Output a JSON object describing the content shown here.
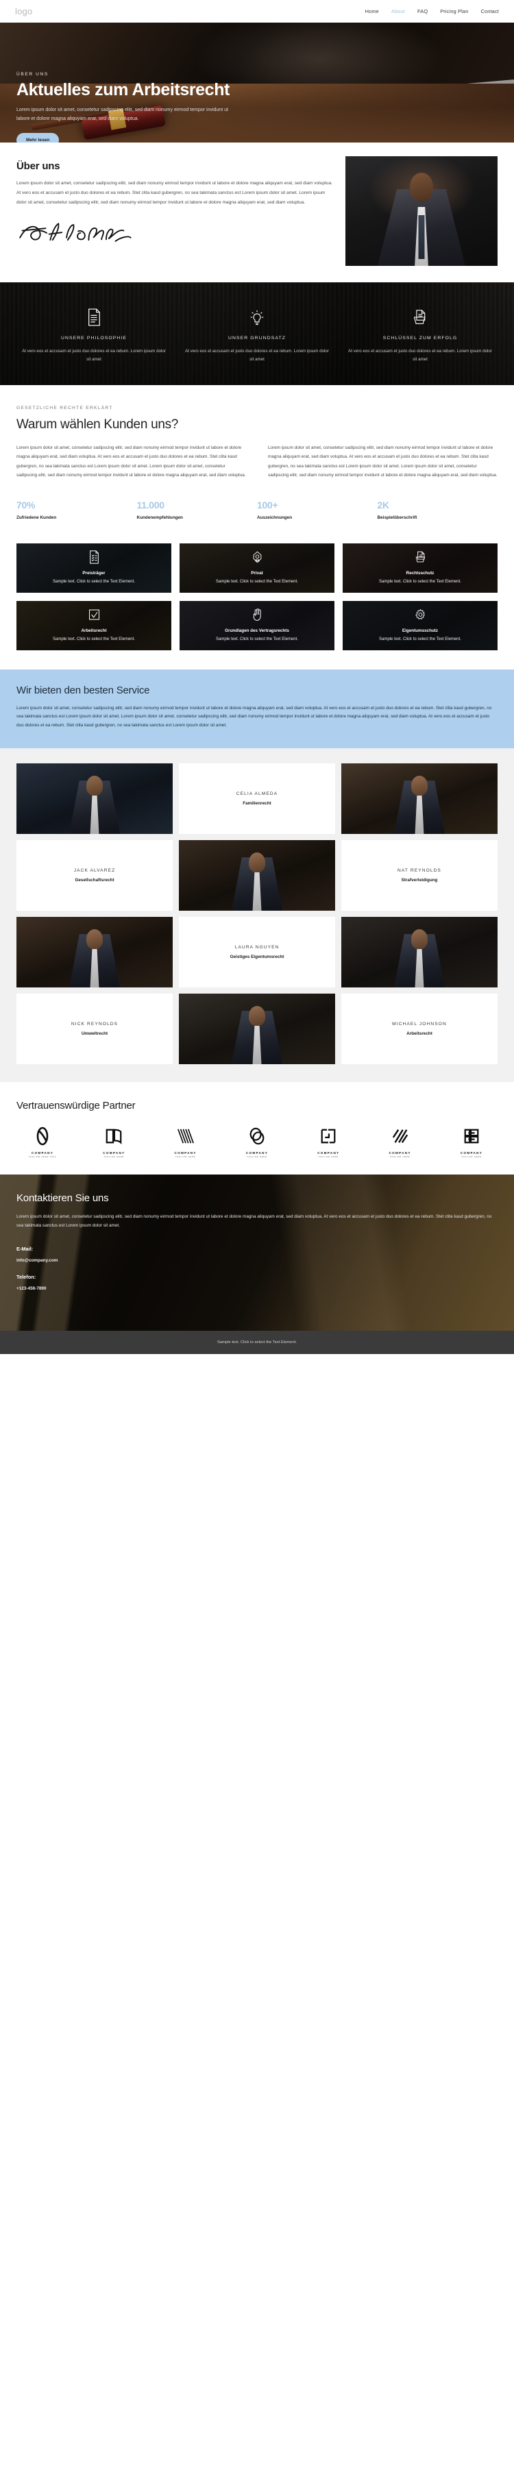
{
  "header": {
    "logo": "logo",
    "nav": [
      {
        "label": "Home",
        "active": false
      },
      {
        "label": "About",
        "active": true
      },
      {
        "label": "FAQ",
        "active": false
      },
      {
        "label": "Pricing Plan",
        "active": false
      },
      {
        "label": "Contact",
        "active": false
      }
    ]
  },
  "hero": {
    "eyebrow": "ÜBER UNS",
    "title": "Aktuelles zum Arbeitsrecht",
    "paragraph": "Lorem ipsum dolor sit amet, consetetur sadipscing elitr, sed diam nonumy eirmod tempor invidunt ut labore et dolore magna aliquyam erat, sed diam voluptua.",
    "button": "Mehr lesen",
    "accent_color": "#aed0ee"
  },
  "about": {
    "title": "Über uns",
    "paragraph": "Lorem ipsum dolor sit amet, consetetur sadipscing elitr, sed diam nonumy eirmod tempor invidunt ut labore et dolore magna aliquyam erat, sed diam voluptua. At vero eos et accusam et justo duo dolores et ea rebum. Stet clita kasd gubergren, no sea takimata sanctus est Lorem ipsum dolor sit amet. Lorem ipsum dolor sit amet, consetetur sadipscing elitr, sed diam nonumy eirmod tempor invidunt ut labore et dolore magna aliquyam erat, sed diam voluptua."
  },
  "features": [
    {
      "icon": "document-lines-icon",
      "title": "UNSERE PHILOSOPHIE",
      "text": "At vero eos et accusam et justo duo dolores et ea rebum. Lorem ipsum dolor sit amet"
    },
    {
      "icon": "lightbulb-icon",
      "title": "UNSER GRUNDSATZ",
      "text": "At vero eos et accusam et justo duo dolores et ea rebum. Lorem ipsum dolor sit amet"
    },
    {
      "icon": "folder-document-icon",
      "title": "SCHLÜSSEL ZUM ERFOLG",
      "text": "At vero eos et accusam et justo duo dolores et ea rebum. Lorem ipsum dolor sit amet"
    }
  ],
  "why": {
    "kicker": "GESETZLICHE RECHTE ERKLÄRT",
    "title": "Warum wählen Kunden uns?",
    "col1": "Lorem ipsum dolor sit amet, consetetur sadipscing elitr, sed diam nonumy eirmod tempor invidunt ut labore et dolore magna aliquyam erat, sed diam voluptua. At vero eos et accusam et justo duo dolores et ea rebum. Stet clita kasd gubergren, no sea takimata sanctus est Lorem ipsum dolor sit amet. Lorem ipsum dolor sit amet, consetetur sadipscing elitr, sed diam nonumy eirmod tempor invidunt ut labore et dolore magna aliquyam erat, sed diam voluptua.",
    "col2": "Lorem ipsum dolor sit amet, consetetur sadipscing elitr, sed diam nonumy eirmod tempor invidunt ut labore et dolore magna aliquyam erat, sed diam voluptua. At vero eos et accusam et justo duo dolores et ea rebum. Stet clita kasd gubergren, no sea takimata sanctus est Lorem ipsum dolor sit amet. Lorem ipsum dolor sit amet, consetetur sadipscing elitr, sed diam nonumy eirmod tempor invidunt ut labore et dolore magna aliquyam erat, sed diam voluptua."
  },
  "stats": [
    {
      "value": "70%",
      "label": "Zufriedene Kunden"
    },
    {
      "value": "11.000",
      "label": "Kundenempfehlungen"
    },
    {
      "value": "100+",
      "label": "Auszeichnungen"
    },
    {
      "value": "2K",
      "label": "Beispielüberschrift"
    }
  ],
  "gallery": [
    {
      "icon": "checklist-document-icon",
      "title": "Preisträger",
      "text": "Sample text. Click to select the Text Element."
    },
    {
      "icon": "handshake-icon",
      "title": "Privat",
      "text": "Sample text. Click to select the Text Element."
    },
    {
      "icon": "document-stack-icon",
      "title": "Rechtsschutz",
      "text": "Sample text. Click to select the Text Element."
    },
    {
      "icon": "checkbox-check-icon",
      "title": "Arbeitsrecht",
      "text": "Sample text. Click to select the Text Element."
    },
    {
      "icon": "raised-hand-icon",
      "title": "Grundlagen des Vertragsrechts",
      "text": "Sample text. Click to select the Text Element."
    },
    {
      "icon": "gear-icon",
      "title": "Eigentumsschutz",
      "text": "Sample text. Click to select the Text Element."
    }
  ],
  "service": {
    "title": "Wir bieten den besten Service",
    "text": "Lorem ipsum dolor sit amet, consetetur sadipscing elitr, sed diam nonumy eirmod tempor invidunt ut labore et dolore magna aliquyam erat, sed diam voluptua. At vero eos et accusam et justo duo dolores et ea rebum. Stet clita kasd gubergren, no sea takimata sanctus est Lorem ipsum dolor sit amet. Lorem ipsum dolor sit amet, consetetur sadipscing elitr, sed diam nonumy eirmod tempor invidunt ut labore et dolore magna aliquyam erat, sed diam voluptua. At vero eos et accusam et justo duo dolores et ea rebum. Stet clita kasd gubergren, no sea takimata sanctus est Lorem ipsum dolor sit amet.",
    "background_color": "#aed0ee"
  },
  "team": [
    {
      "name": "CELIA ALMEDA",
      "role": "Familienrecht"
    },
    {
      "name": "JACK ALVAREZ",
      "role": "Gesellschaftsrecht"
    },
    {
      "name": "NAT REYNOLDS",
      "role": "Strafverteidigung"
    },
    {
      "name": "LAURA NGUYEN",
      "role": "Geistiges Eigentumsrecht"
    },
    {
      "name": "NICK REYNOLDS",
      "role": "Umweltrecht"
    },
    {
      "name": "MICHAEL JOHNSON",
      "role": "Arbeitsrecht"
    }
  ],
  "partners": {
    "title": "Vertrauenswürdige Partner",
    "logos": [
      {
        "mark": "oval-loop-logo",
        "name": "COMPANY",
        "tagline": "TAGLINE HERE 2022"
      },
      {
        "mark": "open-book-logo",
        "name": "COMPANY",
        "tagline": "TAGLINE HERE"
      },
      {
        "mark": "striped-v-logo",
        "name": "COMPANY",
        "tagline": "TAGLINE HERE"
      },
      {
        "mark": "double-circle-logo",
        "name": "COMPANY",
        "tagline": "TAGLINE HERE"
      },
      {
        "mark": "bracket-square-logo",
        "name": "COMPANY",
        "tagline": "TAGLINE HERE"
      },
      {
        "mark": "slash-lines-logo",
        "name": "COMPANY",
        "tagline": "TAGLINE HERE"
      },
      {
        "mark": "blocks-b-logo",
        "name": "COMPANY",
        "tagline": "TAGLINE HERE"
      }
    ]
  },
  "contact": {
    "title": "Kontaktieren Sie uns",
    "lead": "Lorem ipsum dolor sit amet, consetetur sadipscing elitr, sed diam nonumy eirmod tempor invidunt ut labore et dolore magna aliquyam erat, sed diam voluptua. At vero eos et accusam et justo duo dolores et ea rebum. Stet clita kasd gubergren, no sea takimata sanctus est Lorem ipsum dolor sit amet.",
    "email_label": "E-Mail:",
    "email_value": "info@company.com",
    "phone_label": "Telefon:",
    "phone_value": "+123-456-7890"
  },
  "footer": {
    "text": "Sample text. Click to select the Text Element."
  }
}
